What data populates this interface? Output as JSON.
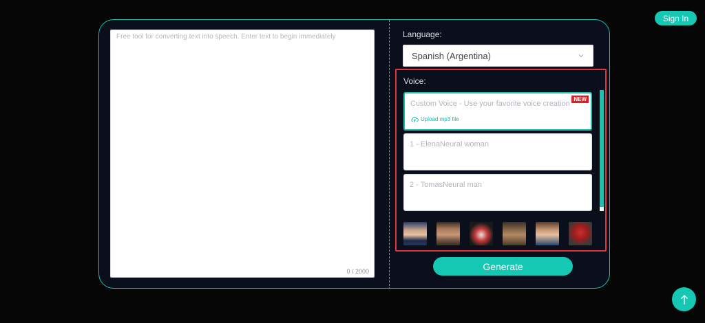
{
  "header": {
    "signin_label": "Sign In"
  },
  "editor": {
    "placeholder": "Free tool for converting text into speech. Enter text to begin immediately",
    "counter": "0 / 2000"
  },
  "language": {
    "label": "Language:",
    "selected": "Spanish (Argentina)"
  },
  "voice": {
    "label": "Voice:",
    "custom": {
      "name": "Custom Voice - Use your favorite voice creation",
      "badge": "NEW",
      "upload_label": "Upload mp3 file"
    },
    "options": [
      {
        "name": "1 - ElenaNeural woman"
      },
      {
        "name": "2 - TomasNeural man"
      }
    ],
    "avatars": [
      "avatar-1",
      "avatar-2",
      "avatar-3",
      "avatar-4",
      "avatar-5",
      "avatar-6"
    ]
  },
  "actions": {
    "generate_label": "Generate"
  },
  "colors": {
    "accent": "#14c8b3",
    "highlight_border": "#e0353b",
    "panel_bg": "#0b0f1b",
    "badge": "#e41e26"
  },
  "icons": {
    "chevron": "chevron-down-icon",
    "upload": "cloud-upload-icon",
    "back_to_top": "arrow-up-icon"
  }
}
